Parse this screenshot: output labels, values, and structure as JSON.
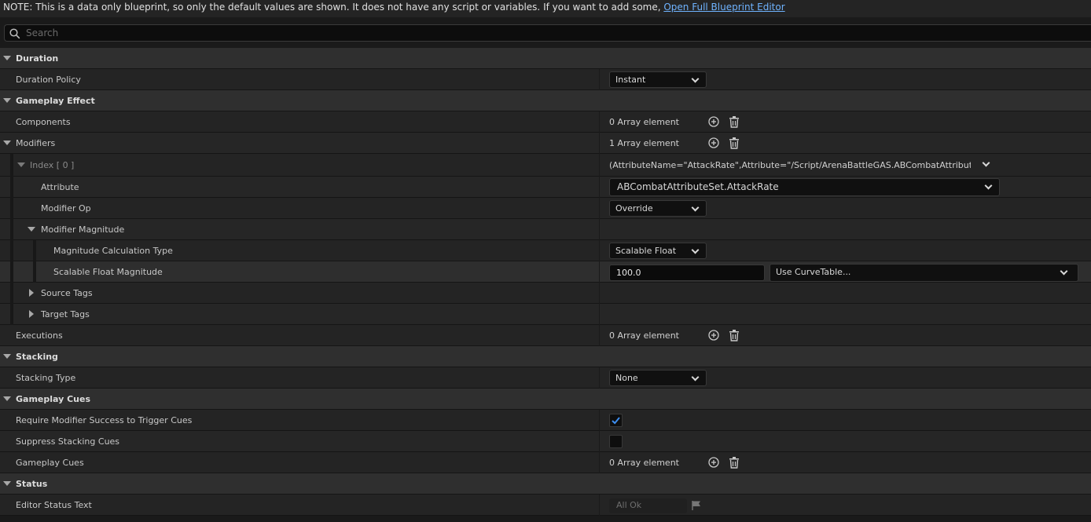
{
  "note": {
    "text": "NOTE: This is a data only blueprint, so only the default values are shown.  It does not have any script or variables.  If you want to add some, ",
    "link": "Open Full Blueprint Editor"
  },
  "search": {
    "placeholder": "Search"
  },
  "duration": {
    "category": "Duration",
    "policy_label": "Duration Policy",
    "policy_value": "Instant"
  },
  "gameplay_effect": {
    "category": "Gameplay Effect",
    "components_label": "Components",
    "components_value": "0 Array element",
    "modifiers_label": "Modifiers",
    "modifiers_value": "1 Array element",
    "index_label": "Index [ 0 ]",
    "index_value": "(AttributeName=\"AttackRate\",Attribute=\"/Script/ArenaBattleGAS.ABCombatAttributeSet:Att",
    "attribute_label": "Attribute",
    "attribute_value": "ABCombatAttributeSet.AttackRate",
    "modifier_op_label": "Modifier Op",
    "modifier_op_value": "Override",
    "magnitude_label": "Modifier Magnitude",
    "calc_type_label": "Magnitude Calculation Type",
    "calc_type_value": "Scalable Float",
    "scalable_label": "Scalable Float Magnitude",
    "scalable_value": "100.0",
    "curve_table": "Use CurveTable...",
    "source_tags_label": "Source Tags",
    "target_tags_label": "Target Tags",
    "executions_label": "Executions",
    "executions_value": "0 Array element"
  },
  "stacking": {
    "category": "Stacking",
    "type_label": "Stacking Type",
    "type_value": "None"
  },
  "gameplay_cues": {
    "category": "Gameplay Cues",
    "require_label": "Require Modifier Success to Trigger Cues",
    "require_checked": true,
    "suppress_label": "Suppress Stacking Cues",
    "suppress_checked": false,
    "cues_label": "Gameplay Cues",
    "cues_value": "0 Array element"
  },
  "status": {
    "category": "Status",
    "text_label": "Editor Status Text",
    "text_value": "All Ok"
  },
  "colors": {
    "link": "#6fb3ff",
    "check": "#3d8ef0"
  }
}
